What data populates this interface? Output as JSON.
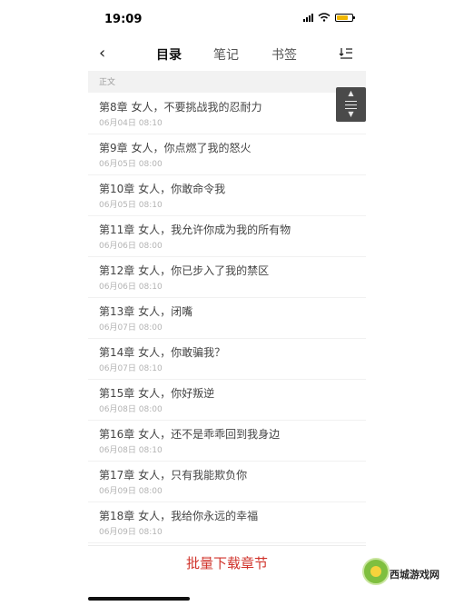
{
  "status_bar": {
    "time": "19:09"
  },
  "nav": {
    "back_icon": "chevron-left-icon",
    "tabs": [
      {
        "label": "目录",
        "active": true
      },
      {
        "label": "笔记",
        "active": false
      },
      {
        "label": "书签",
        "active": false
      }
    ],
    "download_icon": "download-sort-icon"
  },
  "section": {
    "label": "正文"
  },
  "chapters": [
    {
      "title": "第8章 女人，不要挑战我的忍耐力",
      "date": "06月04日  08:10"
    },
    {
      "title": "第9章 女人，你点燃了我的怒火",
      "date": "06月05日  08:00"
    },
    {
      "title": "第10章 女人，你敢命令我",
      "date": "06月05日  08:10"
    },
    {
      "title": "第11章 女人，我允许你成为我的所有物",
      "date": "06月06日  08:00"
    },
    {
      "title": "第12章 女人，你已步入了我的禁区",
      "date": "06月06日  08:10"
    },
    {
      "title": "第13章 女人，闭嘴",
      "date": "06月07日  08:00"
    },
    {
      "title": "第14章 女人，你敢骗我？",
      "date": "06月07日  08:10"
    },
    {
      "title": "第15章 女人，你好叛逆",
      "date": "06月08日  08:00"
    },
    {
      "title": "第16章 女人，还不是乖乖回到我身边",
      "date": "06月08日  08:10"
    },
    {
      "title": "第17章 女人，只有我能欺负你",
      "date": "06月09日  08:00"
    },
    {
      "title": "第18章 女人，我给你永远的幸福",
      "date": "06月09日  08:10"
    }
  ],
  "bottom": {
    "download_label": "批量下载章节"
  },
  "watermark": {
    "text": "西城游戏网"
  },
  "colors": {
    "accent": "#d0332b",
    "battery": "#f0b600"
  }
}
